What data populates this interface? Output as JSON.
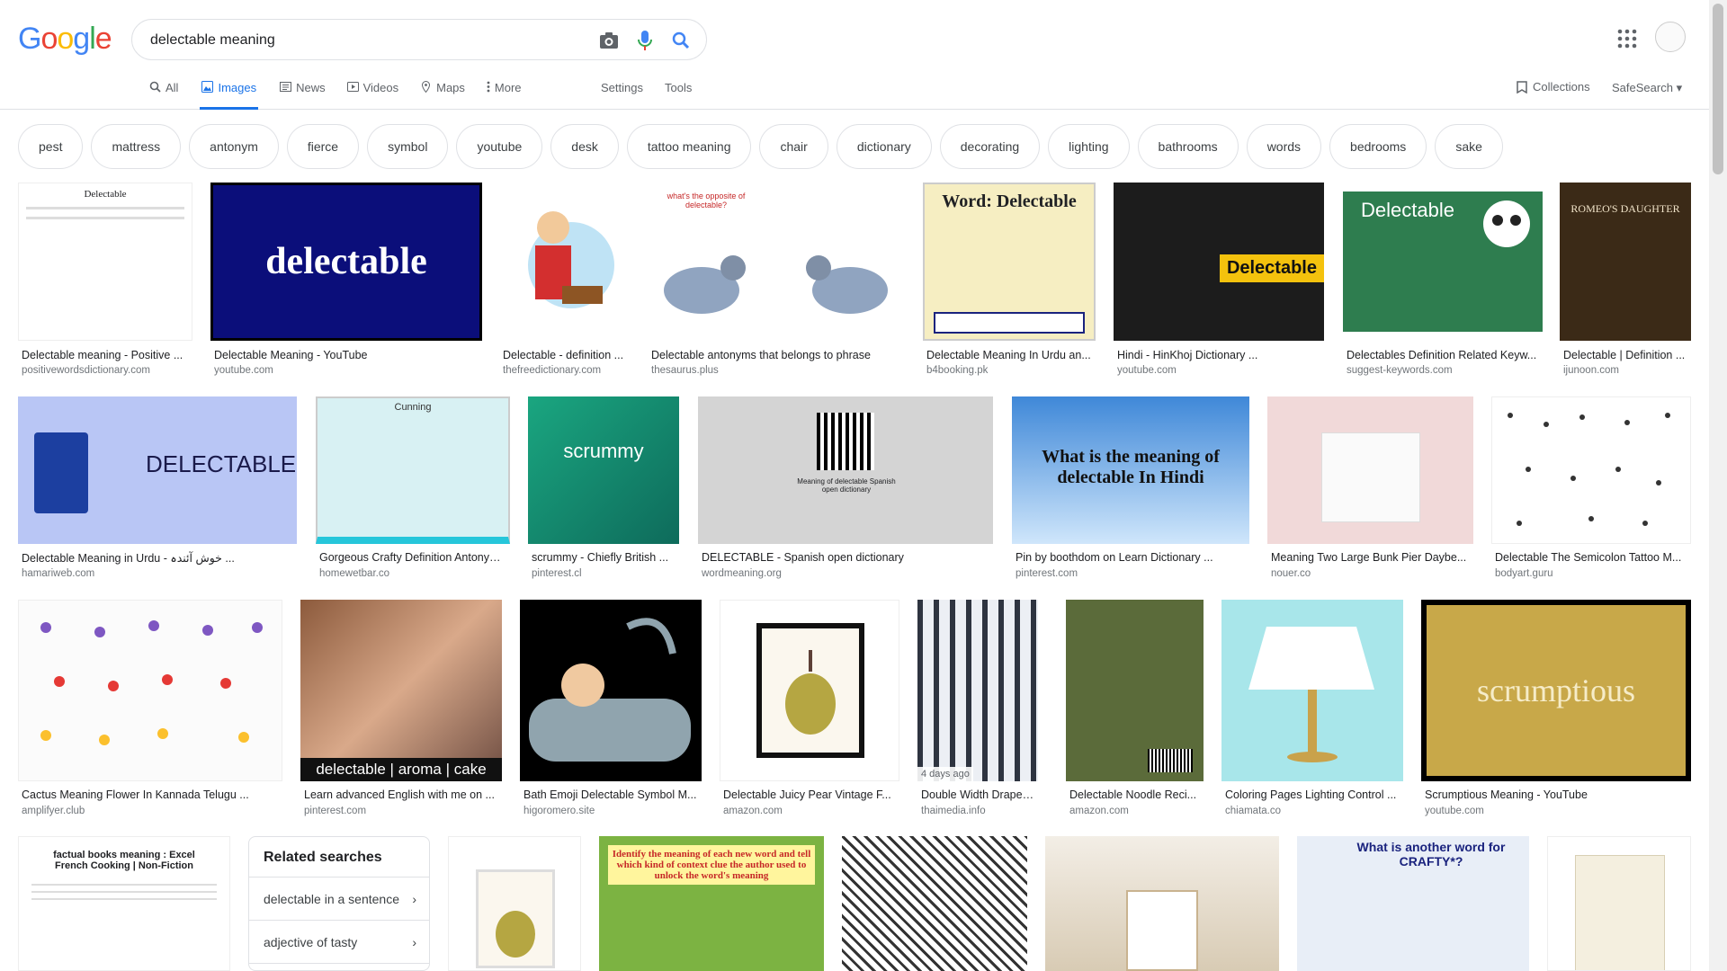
{
  "search": {
    "query": "delectable meaning"
  },
  "logo": {
    "text": "Google"
  },
  "tabs": [
    {
      "label": "All",
      "icon": "search-icon"
    },
    {
      "label": "Images",
      "icon": "image-icon",
      "active": true
    },
    {
      "label": "News",
      "icon": "news-icon"
    },
    {
      "label": "Videos",
      "icon": "video-icon"
    },
    {
      "label": "Maps",
      "icon": "map-icon"
    },
    {
      "label": "More",
      "icon": "more-vert-icon"
    }
  ],
  "tools": {
    "settings": "Settings",
    "tools": "Tools",
    "collections": "Collections",
    "safesearch": "SafeSearch"
  },
  "chips": [
    "pest",
    "mattress",
    "antonym",
    "fierce",
    "symbol",
    "youtube",
    "desk",
    "tattoo meaning",
    "chair",
    "dictionary",
    "decorating",
    "lighting",
    "bathrooms",
    "words",
    "bedrooms",
    "sake"
  ],
  "results": [
    {
      "title": "Delectable meaning - Positive ...",
      "source": "positivewordsdictionary.com",
      "thumb_text": "Delectable"
    },
    {
      "title": "Delectable Meaning - YouTube",
      "source": "youtube.com",
      "thumb_text": "delectable"
    },
    {
      "title": "Delectable - definition ...",
      "source": "thefreedictionary.com",
      "thumb_text": ""
    },
    {
      "title": "Delectable antonyms that belongs to phrase",
      "source": "thesaurus.plus",
      "thumb_text": "what's the opposite of delectable?"
    },
    {
      "title": "Delectable Meaning In Urdu an...",
      "source": "b4booking.pk",
      "thumb_text": "Word: Delectable"
    },
    {
      "title": "Hindi - HinKhoj Dictionary ...",
      "source": "youtube.com",
      "thumb_text": "Delectable"
    },
    {
      "title": "Delectables Definition Related Keyw...",
      "source": "suggest-keywords.com",
      "thumb_text": "Delectable"
    },
    {
      "title": "Delectable | Definition ...",
      "source": "ijunoon.com",
      "thumb_text": "ROMEO'S DAUGHTER"
    },
    {
      "title": "Delectable Meaning in Urdu - خوش آئندہ ...",
      "source": "hamariweb.com",
      "thumb_text": "DELECTABLE"
    },
    {
      "title": "Gorgeous Crafty Definition Antonym...",
      "source": "homewetbar.co",
      "thumb_text": "Cunning"
    },
    {
      "title": "scrummy - Chiefly British ...",
      "source": "pinterest.cl",
      "thumb_text": "scrummy"
    },
    {
      "title": "DELECTABLE - Spanish open dictionary",
      "source": "wordmeaning.org",
      "thumb_text": "Meaning of delectable Spanish open dictionary"
    },
    {
      "title": "Pin by boothdom on Learn Dictionary ...",
      "source": "pinterest.com",
      "thumb_text": "What is the meaning of delectable In Hindi"
    },
    {
      "title": "Meaning Two Large Bunk Pier Daybe...",
      "source": "nouer.co",
      "thumb_text": ""
    },
    {
      "title": "Delectable The Semicolon Tattoo M...",
      "source": "bodyart.guru",
      "thumb_text": ""
    },
    {
      "title": "Cactus Meaning Flower In Kannada Telugu ...",
      "source": "amplifyer.club",
      "thumb_text": ""
    },
    {
      "title": "Learn advanced English with me on ...",
      "source": "pinterest.com",
      "thumb_text": "delectable | aroma | cake"
    },
    {
      "title": "Bath Emoji Delectable Symbol M...",
      "source": "higoromero.site",
      "thumb_text": ""
    },
    {
      "title": "Delectable Juicy Pear Vintage F...",
      "source": "amazon.com",
      "thumb_text": ""
    },
    {
      "title": "Double Width Drapes ...",
      "source": "thaimedia.info",
      "thumb_text": "",
      "badge": "4 days ago"
    },
    {
      "title": "Delectable Noodle Reci...",
      "source": "amazon.com",
      "thumb_text": ""
    },
    {
      "title": "Coloring Pages Lighting Control ...",
      "source": "chiamata.co",
      "thumb_text": ""
    },
    {
      "title": "Scrumptious Meaning - YouTube",
      "source": "youtube.com",
      "thumb_text": "scrumptious"
    }
  ],
  "bottom_row": [
    {
      "thumb_text": "factual books meaning : Excel French Cooking | Non-Fiction"
    },
    {
      "thumb_text": ""
    },
    {
      "thumb_text": "Identify the meaning of each new word and tell which kind of context clue the author used to unlock the word's meaning"
    },
    {
      "thumb_text": ""
    },
    {
      "thumb_text": ""
    },
    {
      "thumb_text": "What is another word for CRAFTY*?"
    },
    {
      "thumb_text": ""
    }
  ],
  "related": {
    "heading": "Related searches",
    "items": [
      "delectable in a sentence",
      "adjective of tasty"
    ]
  },
  "colors": {
    "accent": "#1a73e8",
    "border": "#dfe1e5",
    "text_secondary": "#70757a"
  }
}
